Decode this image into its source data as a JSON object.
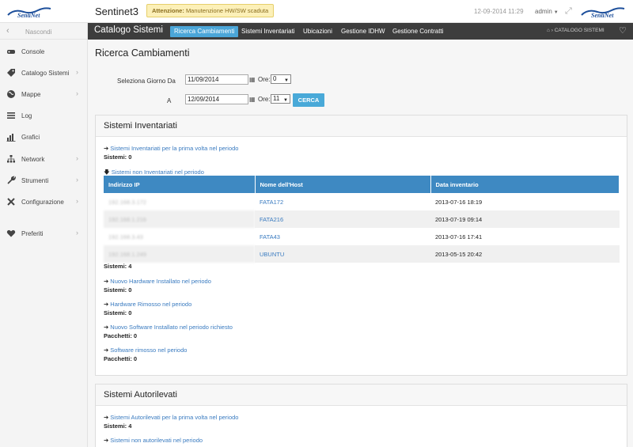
{
  "header": {
    "app_title": "Sentinet3",
    "alert_bold": "Attenzione:",
    "alert_text": "Manutenzione HW/SW scaduta",
    "datetime": "12-09-2014 11:29",
    "user": "admin",
    "logo_alt": "SentiNet"
  },
  "sidebar": {
    "hide_label": "Nascondi",
    "items": [
      {
        "label": "Console",
        "icon": "gamepad-icon",
        "arrow": false
      },
      {
        "label": "Catalogo Sistemi",
        "icon": "tag-icon",
        "arrow": true
      },
      {
        "label": "Mappe",
        "icon": "globe-icon",
        "arrow": true
      },
      {
        "label": "Log",
        "icon": "list-icon",
        "arrow": false
      },
      {
        "label": "Grafici",
        "icon": "bar-chart-icon",
        "arrow": false
      },
      {
        "label": "Network",
        "icon": "sitemap-icon",
        "arrow": true
      },
      {
        "label": "Strumenti",
        "icon": "wrench-icon",
        "arrow": true
      },
      {
        "label": "Configurazione",
        "icon": "tools-icon",
        "arrow": true
      },
      {
        "label": "Preferiti",
        "icon": "heart-icon",
        "arrow": true
      }
    ]
  },
  "navbar": {
    "section": "Catalogo Sistemi",
    "tabs": [
      "Ricerca Cambiamenti",
      "Sistemi Inventariati",
      "Ubicazioni",
      "Gestione IDHW",
      "Gestione Contratti"
    ],
    "active_tab": "Ricerca Cambiamenti",
    "breadcrumb": "CATALOGO SISTEMI"
  },
  "form": {
    "title": "Ricerca Cambiamenti",
    "from_label": "Seleziona Giorno Da",
    "to_label": "A",
    "from_date": "11/09/2014",
    "to_date": "12/09/2014",
    "ore_label": "Ore:",
    "from_hour": "0",
    "to_hour": "11",
    "search_button": "CERCA"
  },
  "inventariati": {
    "title": "Sistemi Inventariati",
    "first_time_link": "Sistemi Inventariati per la prima volta nel periodo",
    "first_time_count": "Sistemi: 0",
    "not_inv_link": "Sistemi non Inventariati nel periodo",
    "table": {
      "headers": [
        "Indirizzo IP",
        "Nome dell'Host",
        "Data inventario"
      ],
      "rows": [
        {
          "ip": "192.168.3.172",
          "host": "FATA172",
          "date": "2013-07-16 18:19"
        },
        {
          "ip": "192.168.1.216",
          "host": "FATA216",
          "date": "2013-07-19 09:14"
        },
        {
          "ip": "192.168.3.43",
          "host": "FATA43",
          "date": "2013-07-16 17:41"
        },
        {
          "ip": "192.168.1.249",
          "host": "UBUNTU",
          "date": "2013-05-15 20:42"
        }
      ]
    },
    "not_inv_count": "Sistemi: 4",
    "new_hw_link": "Nuovo Hardware Installato nel periodo",
    "new_hw_count": "Sistemi: 0",
    "removed_hw_link": "Hardware Rimosso nel periodo",
    "removed_hw_count": "Sistemi: 0",
    "new_sw_link": "Nuovo Software Installato nel periodo richiesto",
    "new_sw_count": "Pacchetti: 0",
    "removed_sw_link": "Software rimosso nel periodo",
    "removed_sw_count": "Pacchetti: 0"
  },
  "autorilevati": {
    "title": "Sistemi Autorilevati",
    "first_time_link": "Sistemi Autorilevati per la prima volta nel periodo",
    "first_time_count": "Sistemi: 4",
    "not_auto_link": "Sistemi non autorilevati nel periodo"
  },
  "colors": {
    "nav_dark": "#3d3d3d",
    "accent": "#4ba6d8",
    "table_header": "#3e89c2",
    "link": "#3a7bc0",
    "alert_bg": "#fcf0b8"
  }
}
